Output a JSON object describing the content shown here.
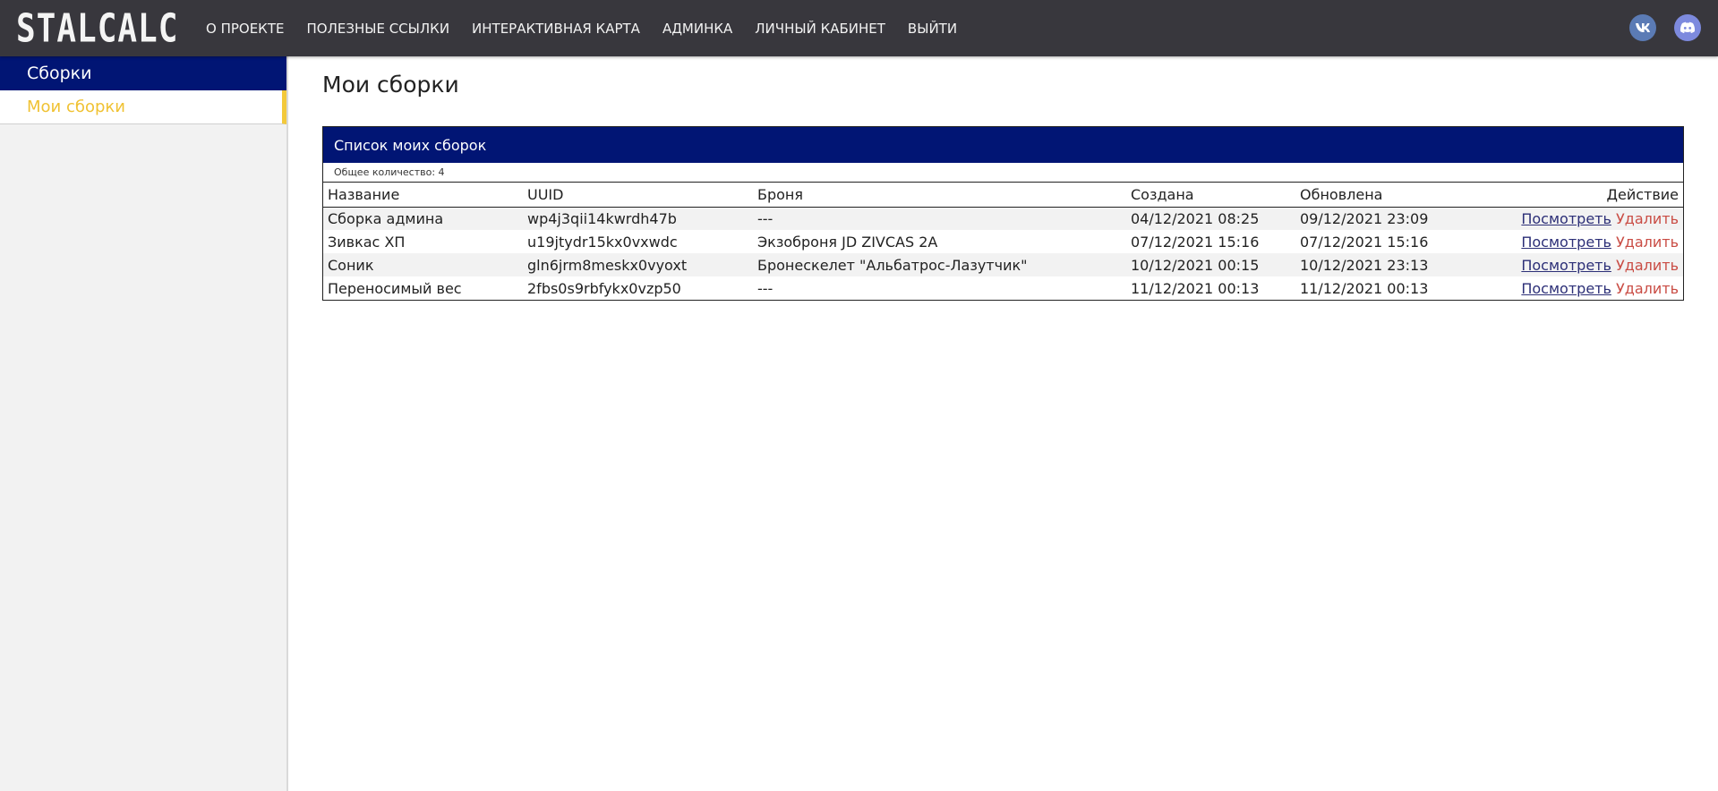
{
  "header": {
    "logo": "STALCALC",
    "nav": [
      "О ПРОЕКТЕ",
      "ПОЛЕЗНЫЕ ССЫЛКИ",
      "ИНТЕРАКТИВНАЯ КАРТА",
      "АДМИНКА",
      "ЛИЧНЫЙ КАБИНЕТ",
      "ВЫЙТИ"
    ],
    "social": [
      {
        "icon": "vk-icon",
        "label": "VK"
      },
      {
        "icon": "discord-icon",
        "label": "Discord"
      }
    ]
  },
  "sidebar": {
    "header": "Сборки",
    "items": [
      {
        "label": "Мои сборки",
        "active": true
      }
    ]
  },
  "main": {
    "title": "Мои сборки",
    "panel": {
      "title": "Список моих сборок",
      "count_text": "Общее количество: 4",
      "columns": [
        "Название",
        "UUID",
        "Броня",
        "Создана",
        "Обновлена",
        "Действие"
      ],
      "rows": [
        {
          "name": "Сборка админа",
          "uuid": "wp4j3qii14kwrdh47b",
          "armor": "---",
          "created": "04/12/2021 08:25",
          "updated": "09/12/2021 23:09"
        },
        {
          "name": "Зивкас ХП",
          "uuid": "u19jtydr15kx0vxwdc",
          "armor": "Экзоброня JD ZIVCAS 2A",
          "created": "07/12/2021 15:16",
          "updated": "07/12/2021 15:16"
        },
        {
          "name": "Соник",
          "uuid": "gln6jrm8meskx0vyoxt",
          "armor": "Бронескелет \"Альбатрос-Лазутчик\"",
          "created": "10/12/2021 00:15",
          "updated": "10/12/2021 23:13"
        },
        {
          "name": "Переносимый вес",
          "uuid": "2fbs0s9rbfykx0vzp50",
          "armor": "---",
          "created": "11/12/2021 00:13",
          "updated": "11/12/2021 00:13"
        }
      ],
      "actions": {
        "view": "Посмотреть",
        "delete": "Удалить"
      }
    }
  },
  "colors": {
    "topbar": "#38373d",
    "accent_blue": "#011574",
    "accent_yellow": "#f3c93b",
    "delete_red": "#c94b43",
    "link_blue": "#2c2f77"
  }
}
